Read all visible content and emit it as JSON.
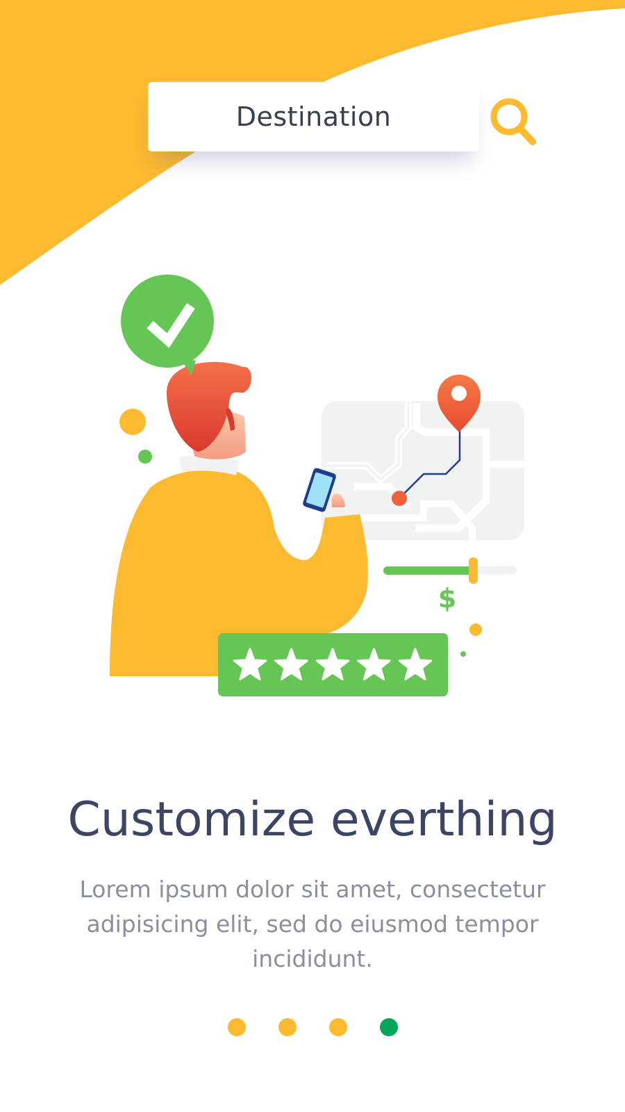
{
  "colors": {
    "accent": "#FBBA30",
    "success": "#66C655",
    "pin": "#F0603A",
    "title": "#3C4664",
    "body": "#8B8E9C",
    "active_dot": "#00A65A",
    "route": "#1F3D8A"
  },
  "search": {
    "placeholder": "Destination",
    "icon": "search-icon"
  },
  "illustration": {
    "checkmark_icon": "check-icon",
    "pin_icon": "map-pin-icon",
    "currency_symbol": "$",
    "rating_stars": 5,
    "rating_max": 5,
    "price_slider_level": 0.68
  },
  "onboarding": {
    "title": "Customize everthing",
    "description": "Lorem ipsum dolor sit amet, consectetur adipisicing elit, sed do eiusmod tempor incididunt."
  },
  "pagination": {
    "total": 4,
    "active_index": 3
  }
}
